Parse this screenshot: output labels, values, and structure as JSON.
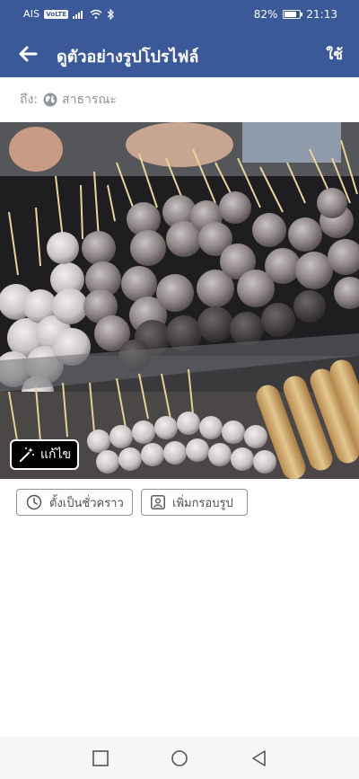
{
  "status_bar": {
    "carrier": "AIS",
    "volte": "VoLTE",
    "battery_percent": "82%",
    "battery_level": 0.82,
    "time": "21:13"
  },
  "header": {
    "back_icon": "arrow-left-icon",
    "title": "ดูตัวอย่างรูปโปรไฟล์",
    "use_label": "ใช้",
    "background_color": "#3b5998"
  },
  "audience": {
    "label": "ถึง:",
    "icon": "globe-icon",
    "value": "สาธารณะ"
  },
  "photo": {
    "edit_label": "แก้ไข",
    "edit_icon": "magic-wand-icon"
  },
  "options": {
    "temporary_label": "ตั้งเป็นชั่วคราว",
    "temporary_icon": "clock-icon",
    "frame_label": "เพิ่มกรอบรูป",
    "frame_icon": "profile-frame-icon"
  },
  "nav_bar": {
    "items": [
      "recent-apps-icon",
      "home-icon",
      "back-triangle-icon"
    ]
  }
}
